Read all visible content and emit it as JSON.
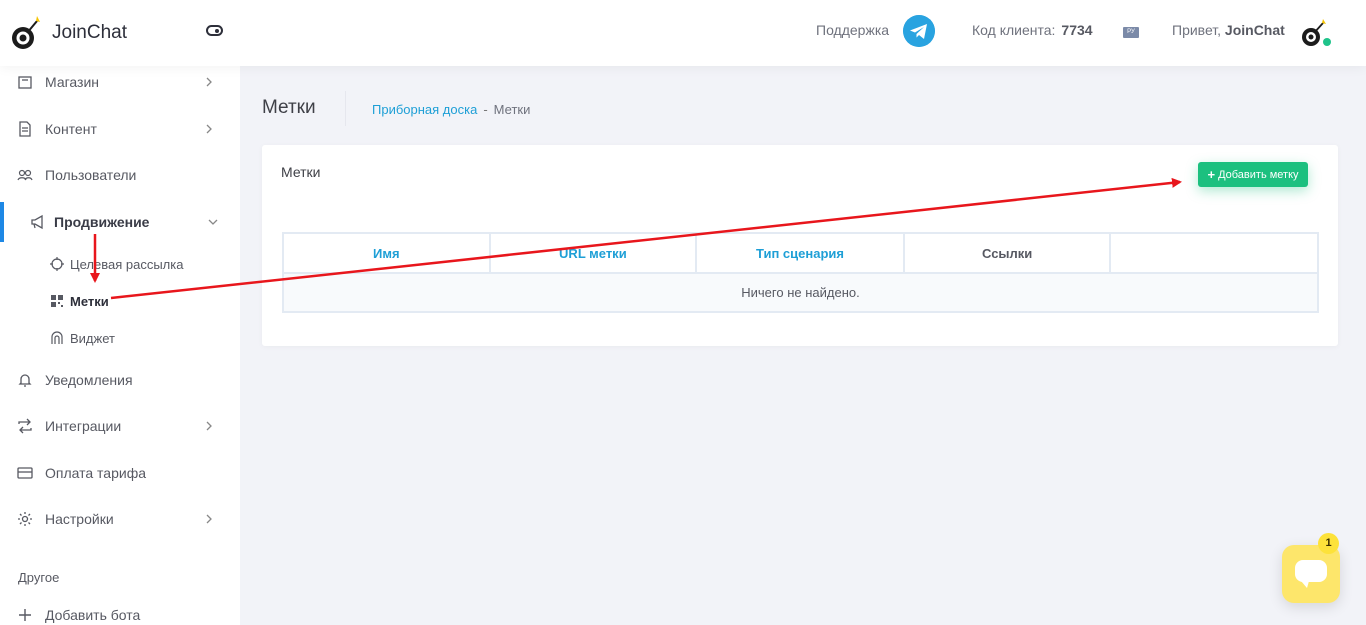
{
  "header": {
    "brand_name": "JoinChat",
    "support_label": "Поддержка",
    "client_code_label": "Код клиента:",
    "client_code_value": "7734",
    "language": "РУ",
    "greeting": "Привет,",
    "username": "JoinChat"
  },
  "sidebar": {
    "items": [
      {
        "label": "Магазин",
        "icon": "store-icon",
        "has_children": true
      },
      {
        "label": "Контент",
        "icon": "document-icon",
        "has_children": true
      },
      {
        "label": "Пользователи",
        "icon": "users-icon",
        "has_children": false
      },
      {
        "label": "Продвижение",
        "icon": "megaphone-icon",
        "has_children": true,
        "expanded": true
      },
      {
        "label": "Уведомления",
        "icon": "bell-icon",
        "has_children": false
      },
      {
        "label": "Интеграции",
        "icon": "sync-icon",
        "has_children": true
      },
      {
        "label": "Оплата тарифа",
        "icon": "credit-card-icon",
        "has_children": false
      },
      {
        "label": "Настройки",
        "icon": "gear-icon",
        "has_children": true
      }
    ],
    "subitems": [
      {
        "label": "Целевая рассылка",
        "icon": "target-icon"
      },
      {
        "label": "Метки",
        "icon": "qr-code-icon",
        "current": true
      },
      {
        "label": "Виджет",
        "icon": "widget-icon"
      }
    ],
    "section_other": "Другое",
    "add_bot": "Добавить бота"
  },
  "page": {
    "title": "Метки",
    "breadcrumb": {
      "link": "Приборная доска",
      "separator": "-",
      "current": "Метки"
    }
  },
  "card": {
    "title": "Метки",
    "add_button": "Добавить метку",
    "table": {
      "headers": [
        "Имя",
        "URL метки",
        "Тип сценария",
        "Ссылки",
        ""
      ],
      "empty_text": "Ничего не найдено."
    }
  },
  "chat_widget": {
    "badge_count": "1"
  },
  "colors": {
    "accent": "#1e9fd6",
    "button": "#1cc07f",
    "annotation": "#e8161c",
    "chat": "#fde66b"
  }
}
